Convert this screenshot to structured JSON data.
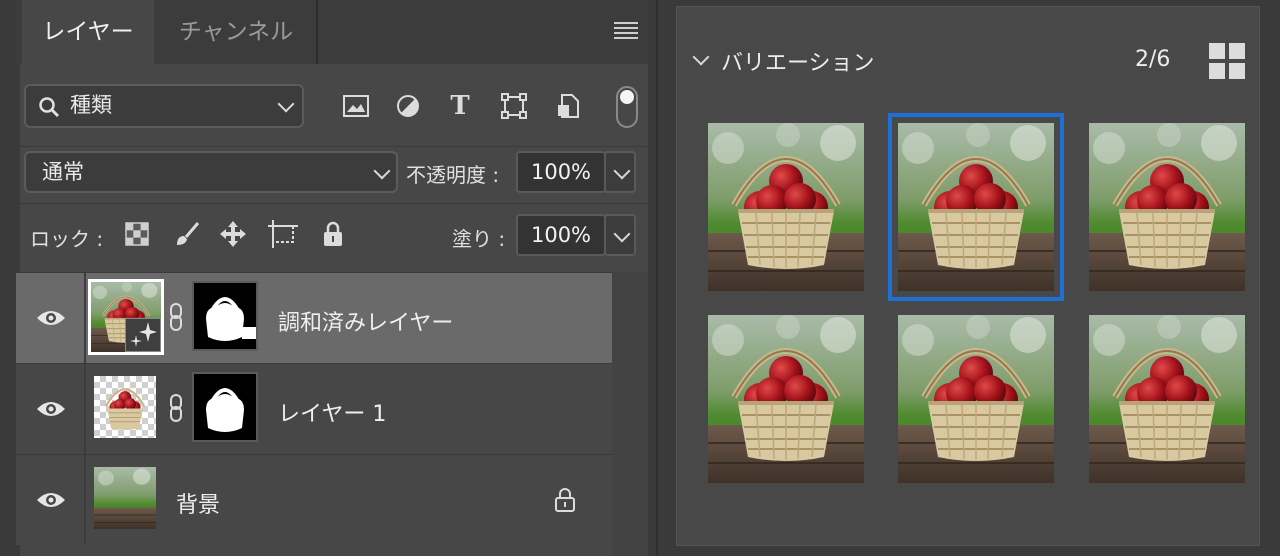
{
  "layers_panel": {
    "tabs": [
      {
        "label": "レイヤー",
        "active": true
      },
      {
        "label": "チャンネル",
        "active": false
      }
    ],
    "filter": {
      "label": "種類",
      "icons": [
        "image-filter-icon",
        "adjustment-filter-icon",
        "type-filter-icon",
        "shape-filter-icon",
        "smart-object-filter-icon"
      ]
    },
    "blend_mode": "通常",
    "opacity": {
      "label": "不透明度 :",
      "value": "100%"
    },
    "lock": {
      "label": "ロック :"
    },
    "fill": {
      "label": "塗り :",
      "value": "100%"
    },
    "layers": [
      {
        "name": "調和済みレイヤー",
        "selected": true,
        "has_mask": true
      },
      {
        "name": "レイヤー 1",
        "selected": false,
        "has_mask": true
      },
      {
        "name": "背景",
        "selected": false,
        "has_mask": false,
        "locked": true
      }
    ]
  },
  "variations_panel": {
    "title": "バリエーション",
    "count": "2/6",
    "selected_index": 1,
    "total": 6
  },
  "colors": {
    "panel_bg": "#474747",
    "selected_row": "#6a6a6a",
    "accent_blue": "#1f6fd6"
  }
}
